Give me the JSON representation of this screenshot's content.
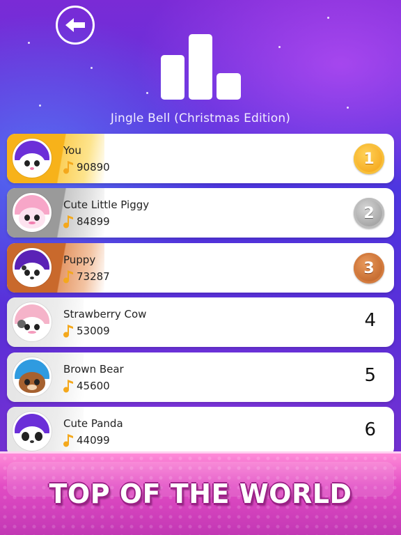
{
  "header": {
    "back_icon": "arrow-left-icon",
    "chart_icon": "leaderboard-bars-icon",
    "song_title": "Jingle Bell (Christmas Edition)"
  },
  "leaderboard": [
    {
      "name": "You",
      "score": "90890",
      "rank": "1",
      "medal": "gold",
      "avatar": "white-cat"
    },
    {
      "name": "Cute Little Piggy",
      "score": "84899",
      "rank": "2",
      "medal": "silver",
      "avatar": "pink-piggy"
    },
    {
      "name": "Puppy",
      "score": "73287",
      "rank": "3",
      "medal": "bronze",
      "avatar": "dalmatian-puppy"
    },
    {
      "name": "Strawberry Cow",
      "score": "53009",
      "rank": "4",
      "medal": "",
      "avatar": "strawberry-cow"
    },
    {
      "name": "Brown Bear",
      "score": "45600",
      "rank": "5",
      "medal": "",
      "avatar": "brown-bear"
    },
    {
      "name": "Cute Panda",
      "score": "44099",
      "rank": "6",
      "medal": "",
      "avatar": "panda"
    }
  ],
  "banner": {
    "title": "TOP OF THE WORLD"
  },
  "colors": {
    "gold": "#f5a316",
    "silver": "#a9a9a9",
    "bronze": "#c9692c",
    "banner_pink": "#e24cc4"
  }
}
